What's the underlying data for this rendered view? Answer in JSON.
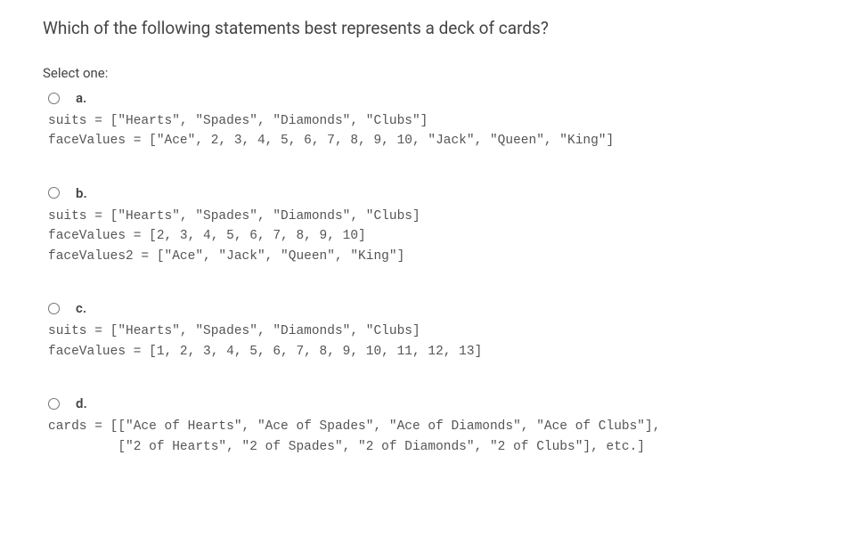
{
  "question": "Which of the following statements best represents a deck of cards?",
  "selectPrompt": "Select one:",
  "options": {
    "a": {
      "label": "a.",
      "code": "suits = [\"Hearts\", \"Spades\", \"Diamonds\", \"Clubs\"]\nfaceValues = [\"Ace\", 2, 3, 4, 5, 6, 7, 8, 9, 10, \"Jack\", \"Queen\", \"King\"]"
    },
    "b": {
      "label": "b.",
      "code": "suits = [\"Hearts\", \"Spades\", \"Diamonds\", \"Clubs]\nfaceValues = [2, 3, 4, 5, 6, 7, 8, 9, 10]\nfaceValues2 = [\"Ace\", \"Jack\", \"Queen\", \"King\"]"
    },
    "c": {
      "label": "c.",
      "code": "suits = [\"Hearts\", \"Spades\", \"Diamonds\", \"Clubs]\nfaceValues = [1, 2, 3, 4, 5, 6, 7, 8, 9, 10, 11, 12, 13]"
    },
    "d": {
      "label": "d.",
      "code": "cards = [[\"Ace of Hearts\", \"Ace of Spades\", \"Ace of Diamonds\", \"Ace of Clubs\"],\n         [\"2 of Hearts\", \"2 of Spades\", \"2 of Diamonds\", \"2 of Clubs\"], etc.]"
    }
  }
}
